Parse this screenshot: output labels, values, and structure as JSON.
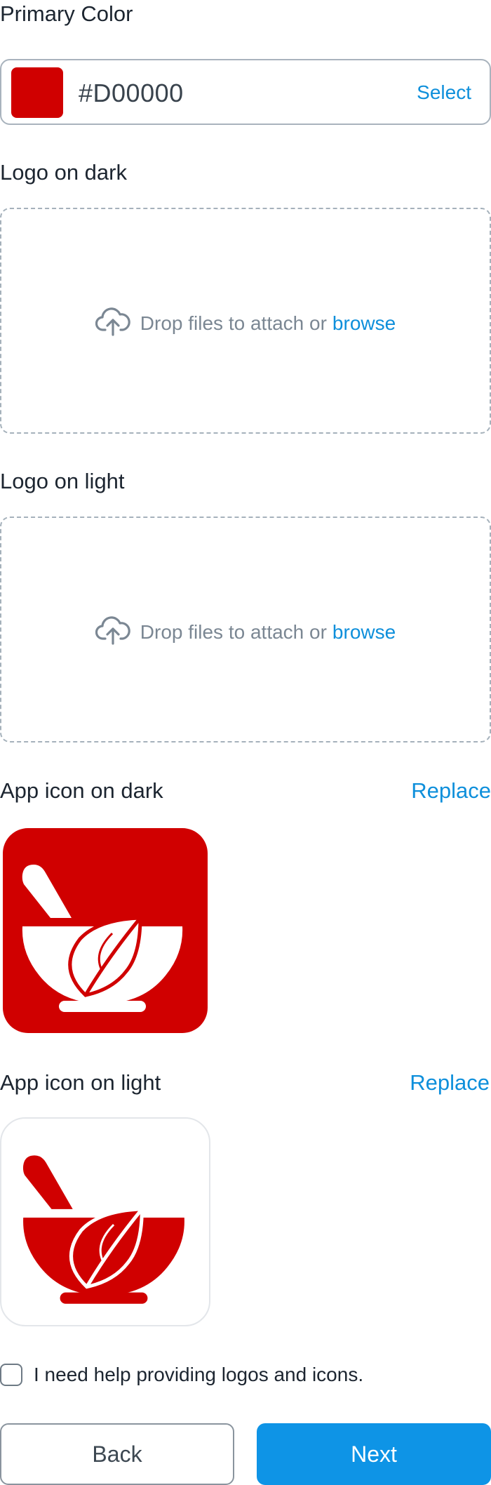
{
  "primary_color": {
    "label": "Primary Color",
    "value": "#D00000",
    "swatch": "#d00000",
    "select_label": "Select"
  },
  "logo_dark": {
    "label": "Logo on dark",
    "icon": "upload-cloud-icon",
    "drop_text": "Drop files to attach or",
    "browse_label": "browse"
  },
  "logo_light": {
    "label": "Logo on light",
    "icon": "upload-cloud-icon",
    "drop_text": "Drop files to attach or",
    "browse_label": "browse"
  },
  "app_icon_dark": {
    "label": "App icon on dark",
    "replace_label": "Replace",
    "icon": "mortar-pestle-leaf-icon",
    "background": "#d00000"
  },
  "app_icon_light": {
    "label": "App icon on light",
    "replace_label": "Replace",
    "icon": "mortar-pestle-leaf-icon",
    "foreground": "#d00000"
  },
  "help_checkbox": {
    "label": "I need help providing logos and icons.",
    "checked": false
  },
  "actions": {
    "back_label": "Back",
    "next_label": "Next"
  },
  "colors": {
    "accent": "#0e8fdb",
    "brand": "#d00000"
  }
}
